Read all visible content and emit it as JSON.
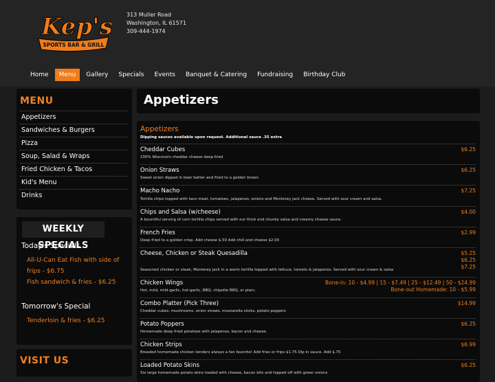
{
  "logo": {
    "script": "Kep's",
    "banner": "SPORTS BAR & GRILL"
  },
  "address": {
    "street": "313 Muller Road",
    "city": "Washington, IL 61571",
    "phone": "309-444-1974"
  },
  "nav": {
    "items": [
      {
        "label": "Home"
      },
      {
        "label": "Menu"
      },
      {
        "label": "Gallery"
      },
      {
        "label": "Specials"
      },
      {
        "label": "Events"
      },
      {
        "label": "Banquet & Catering"
      },
      {
        "label": "Fundraising"
      },
      {
        "label": "Birthday Club"
      }
    ],
    "active": "Menu"
  },
  "sidebar": {
    "menu_title": "MENU",
    "menu_items": [
      {
        "label": "Appetizers"
      },
      {
        "label": "Sandwiches & Burgers"
      },
      {
        "label": "Pizza"
      },
      {
        "label": "Soup, Salad & Wraps"
      },
      {
        "label": "Fried Chicken & Tacos"
      },
      {
        "label": "Kid's Menu"
      },
      {
        "label": "Drinks"
      }
    ],
    "specials_title": "WEEKLY SPECIALS",
    "today_heading": "Today's Specials",
    "today_items": [
      {
        "label": "All-U-Can Eat Fish with side of frips - $6.75"
      },
      {
        "label": "Fish sandwich & fries - $6.25"
      }
    ],
    "tomorrow_heading": "Tomorrow's Special",
    "tomorrow_items": [
      {
        "label": "Tenderloin & fries - $6.25"
      }
    ],
    "visit_title": "VISIT US"
  },
  "page_title": "Appetizers",
  "section": {
    "title": "Appetizers",
    "note": "Dipping sauces available upon request. Additional sauce .35 extra"
  },
  "items": [
    {
      "name": "Cheddar Cubes",
      "desc": "100% Wisconsin cheddar cheese deep-fried",
      "prices": [
        "$6.25"
      ]
    },
    {
      "name": "Onion Straws",
      "desc": "Sweet onion dipped in beer batter and fried to a golden brown",
      "prices": [
        "$6.25"
      ]
    },
    {
      "name": "Macho Nacho",
      "desc": "Tortilla chips topped with taco meat, tomatoes, jalapenos, onions and Monterey jack cheese. Served with sour cream and salsa.",
      "prices": [
        "$7.25"
      ]
    },
    {
      "name": "Chips and Salsa (w/cheese)",
      "desc": "A bountiful serving of corn tortilla chips served with our thick and chunky salsa and creamy cheese sauce.",
      "prices": [
        "$4.00"
      ]
    },
    {
      "name": "French Fries",
      "desc": "Deep fried to a golden crisp. Add cheese $.50 Add chili and cheese $2.00",
      "prices": [
        "$2.99"
      ]
    },
    {
      "name": "Cheese, Chicken or Steak Quesadilla",
      "desc": "Seasoned chicken or steak, Monterey jack in a warm tortilla topped with lettuce, tomato & jalapenos. Served with sour cream & salsa",
      "prices": [
        "$5.25",
        "$6.25",
        "$7.25"
      ]
    },
    {
      "name": "Chicken Wings",
      "desc": "Hot, mild, mild-garlic, hot-garlic, BBQ, chipotle BBQ, or plain.",
      "prices": [
        "Bone-in: 10 - $4.99 | 15 - $7.49 | 25 - $12.49 | 50 - $24.99",
        "Bone-out Homemade: 10 - $5.99"
      ]
    },
    {
      "name": "Combo Platter (Pick Three)",
      "desc": "Cheddar cubes, mushrooms, onion straws, mozzarella sticks, potato poppers",
      "prices": [
        "$14.99"
      ]
    },
    {
      "name": "Potato Poppers",
      "desc": "Homemade deep fried potatoes with jalapenos, bacon and cheese.",
      "prices": [
        "$6.25"
      ]
    },
    {
      "name": "Chicken Strips",
      "desc": "Breaded homemade chicken tenders always a fan favorite! Add fries or frips $1.75 Dip in sauce. Add $.75",
      "prices": [
        "$6.99"
      ]
    },
    {
      "name": "Loaded Potato Skins",
      "desc": "Six large homemade potato skins loaded with cheese, bacon bits and topped off with green onions",
      "prices": [
        "$6.25"
      ]
    }
  ],
  "colors": {
    "accent": "#f07d1a",
    "background": "#1c1c1c",
    "panel": "#0b0b0b"
  }
}
